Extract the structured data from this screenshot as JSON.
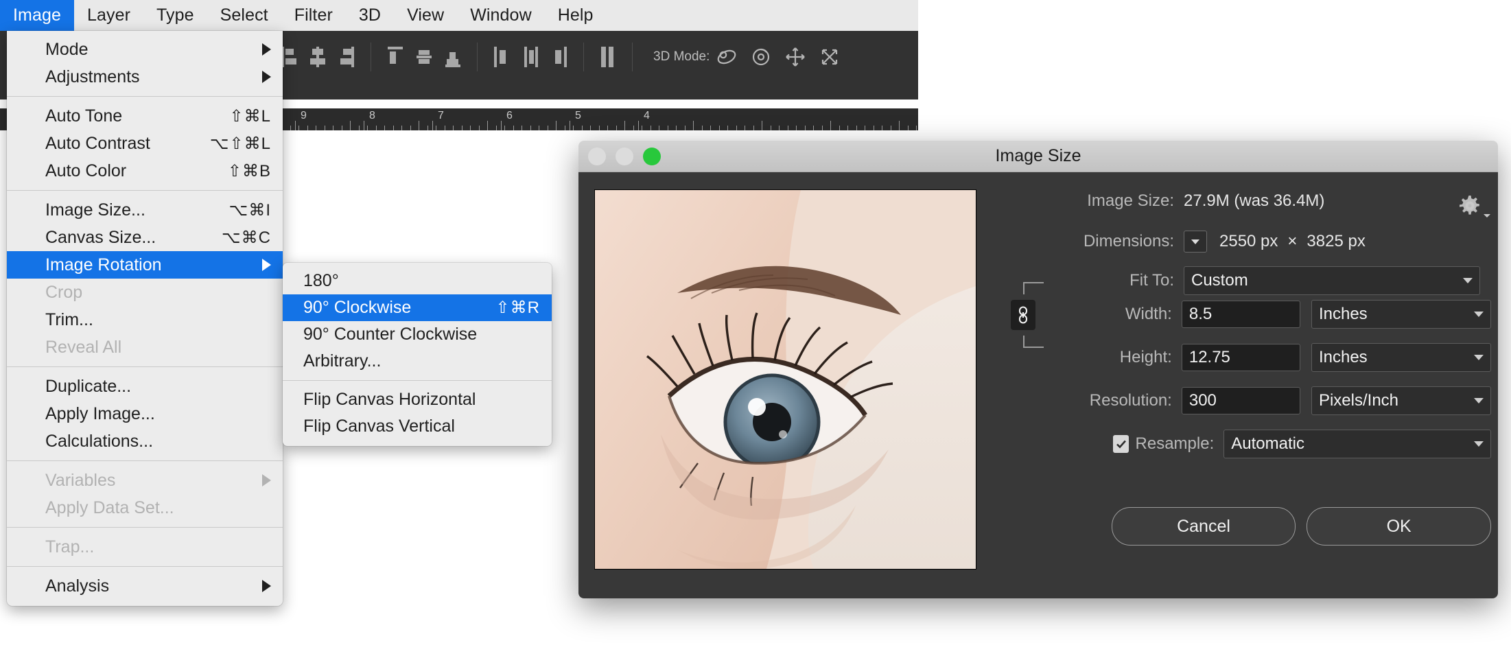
{
  "menubar": {
    "items": [
      {
        "label": "Image",
        "active": true
      },
      {
        "label": "Layer",
        "active": false
      },
      {
        "label": "Type",
        "active": false
      },
      {
        "label": "Select",
        "active": false
      },
      {
        "label": "Filter",
        "active": false
      },
      {
        "label": "3D",
        "active": false
      },
      {
        "label": "View",
        "active": false
      },
      {
        "label": "Window",
        "active": false
      },
      {
        "label": "Help",
        "active": false
      }
    ]
  },
  "toolbar": {
    "mode3d_label": "3D Mode:"
  },
  "ruler": {
    "ticks": [
      "9",
      "8",
      "7",
      "6",
      "5",
      "4"
    ]
  },
  "image_menu": {
    "groups": [
      [
        {
          "label": "Mode",
          "shortcut": "",
          "submenu": true,
          "disabled": false,
          "selected": false
        },
        {
          "label": "Adjustments",
          "shortcut": "",
          "submenu": true,
          "disabled": false,
          "selected": false
        }
      ],
      [
        {
          "label": "Auto Tone",
          "shortcut": "⇧⌘L",
          "submenu": false,
          "disabled": false,
          "selected": false
        },
        {
          "label": "Auto Contrast",
          "shortcut": "⌥⇧⌘L",
          "submenu": false,
          "disabled": false,
          "selected": false
        },
        {
          "label": "Auto Color",
          "shortcut": "⇧⌘B",
          "submenu": false,
          "disabled": false,
          "selected": false
        }
      ],
      [
        {
          "label": "Image Size...",
          "shortcut": "⌥⌘I",
          "submenu": false,
          "disabled": false,
          "selected": false
        },
        {
          "label": "Canvas Size...",
          "shortcut": "⌥⌘C",
          "submenu": false,
          "disabled": false,
          "selected": false
        },
        {
          "label": "Image Rotation",
          "shortcut": "",
          "submenu": true,
          "disabled": false,
          "selected": true
        },
        {
          "label": "Crop",
          "shortcut": "",
          "submenu": false,
          "disabled": true,
          "selected": false
        },
        {
          "label": "Trim...",
          "shortcut": "",
          "submenu": false,
          "disabled": false,
          "selected": false
        },
        {
          "label": "Reveal All",
          "shortcut": "",
          "submenu": false,
          "disabled": true,
          "selected": false
        }
      ],
      [
        {
          "label": "Duplicate...",
          "shortcut": "",
          "submenu": false,
          "disabled": false,
          "selected": false
        },
        {
          "label": "Apply Image...",
          "shortcut": "",
          "submenu": false,
          "disabled": false,
          "selected": false
        },
        {
          "label": "Calculations...",
          "shortcut": "",
          "submenu": false,
          "disabled": false,
          "selected": false
        }
      ],
      [
        {
          "label": "Variables",
          "shortcut": "",
          "submenu": true,
          "disabled": true,
          "selected": false
        },
        {
          "label": "Apply Data Set...",
          "shortcut": "",
          "submenu": false,
          "disabled": true,
          "selected": false
        }
      ],
      [
        {
          "label": "Trap...",
          "shortcut": "",
          "submenu": false,
          "disabled": true,
          "selected": false
        }
      ],
      [
        {
          "label": "Analysis",
          "shortcut": "",
          "submenu": true,
          "disabled": false,
          "selected": false
        }
      ]
    ]
  },
  "rotation_submenu": {
    "groups": [
      [
        {
          "label": "180°",
          "shortcut": "",
          "selected": false
        },
        {
          "label": "90° Clockwise",
          "shortcut": "⇧⌘R",
          "selected": true
        },
        {
          "label": "90° Counter Clockwise",
          "shortcut": "",
          "selected": false
        },
        {
          "label": "Arbitrary...",
          "shortcut": "",
          "selected": false
        }
      ],
      [
        {
          "label": "Flip Canvas Horizontal",
          "shortcut": "",
          "selected": false
        },
        {
          "label": "Flip Canvas Vertical",
          "shortcut": "",
          "selected": false
        }
      ]
    ]
  },
  "dialog": {
    "title": "Image Size",
    "image_size_label": "Image Size:",
    "image_size_value": "27.9M (was 36.4M)",
    "dimensions_label": "Dimensions:",
    "dimensions_width": "2550 px",
    "dimensions_separator": "×",
    "dimensions_height": "3825 px",
    "fit_to_label": "Fit To:",
    "fit_to_value": "Custom",
    "width_label": "Width:",
    "width_value": "8.5",
    "width_unit": "Inches",
    "height_label": "Height:",
    "height_value": "12.75",
    "height_unit": "Inches",
    "resolution_label": "Resolution:",
    "resolution_value": "300",
    "resolution_unit": "Pixels/Inch",
    "resample_label": "Resample:",
    "resample_value": "Automatic",
    "resample_checked": true,
    "cancel_label": "Cancel",
    "ok_label": "OK"
  },
  "colors": {
    "accent": "#1473e6",
    "menu_bg": "#ececec",
    "dialog_bg": "#383838",
    "traffic_green": "#28c83c"
  }
}
